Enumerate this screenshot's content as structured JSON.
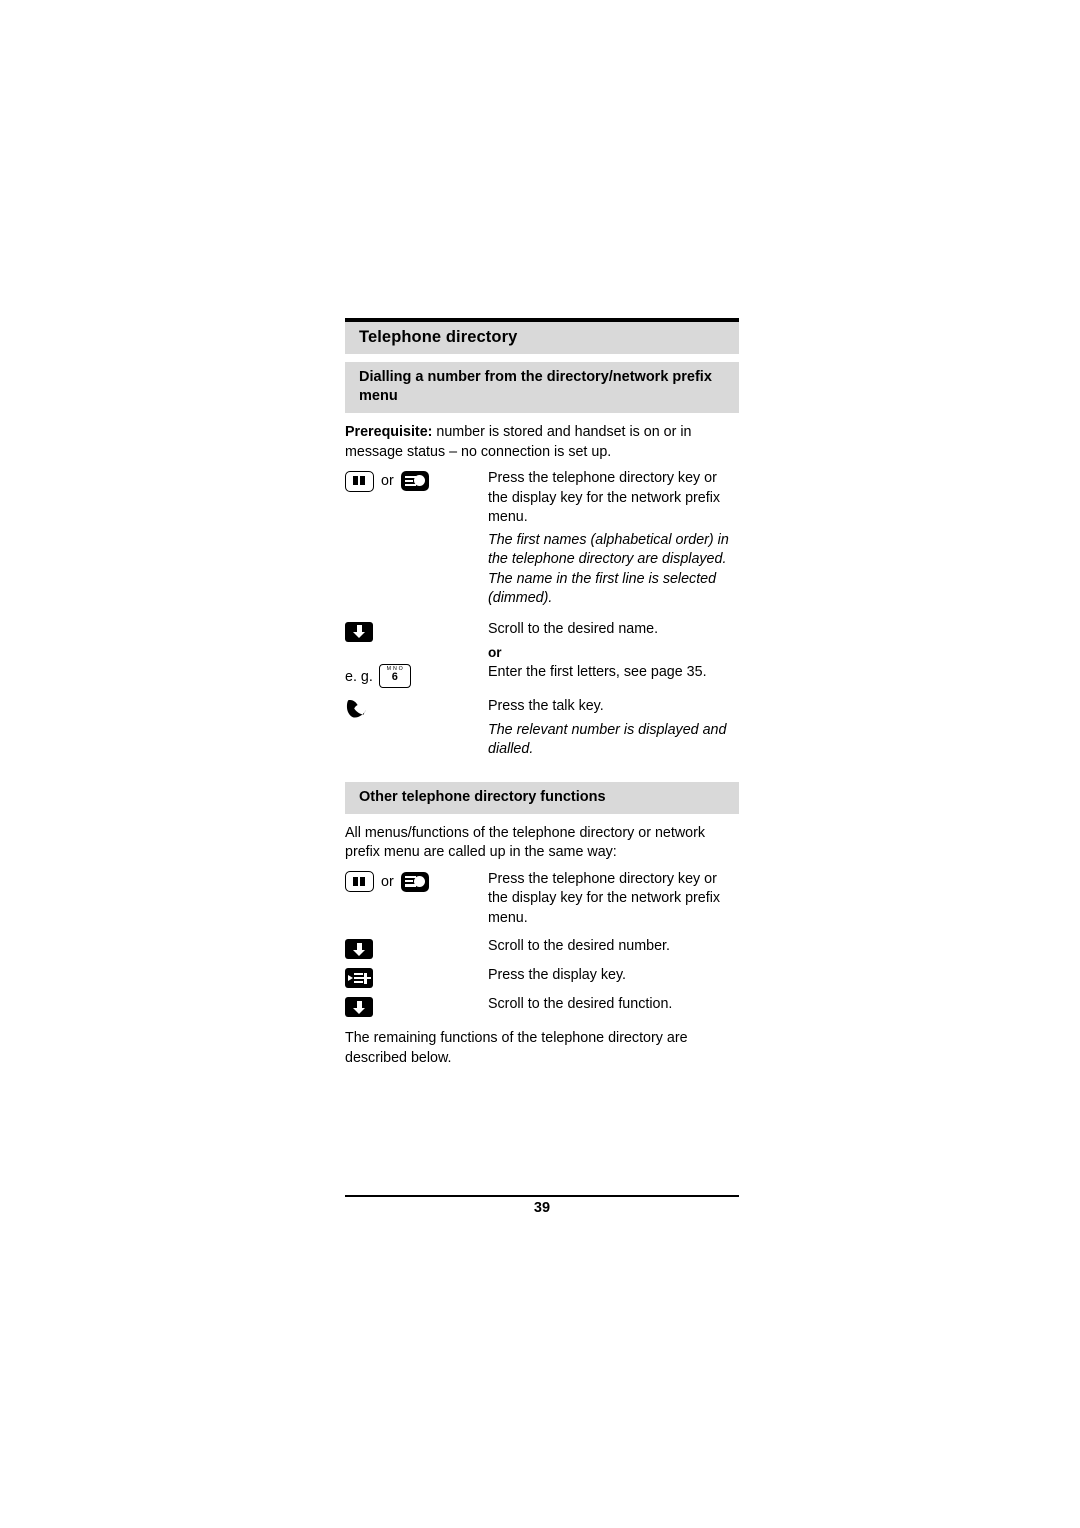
{
  "document": {
    "chapter_title": "Telephone directory",
    "page_number": "39",
    "sections": [
      {
        "heading": "Dialling a number from the directory/network prefix menu",
        "prerequisite_label": "Prerequisite:",
        "prerequisite_text": " number is stored and handset is on or in message status – no connection is set up.",
        "steps": [
          {
            "icons": "phonebook-key or display-key",
            "text": "Press the telephone directory key or the display key for the network prefix menu.",
            "note": "The first names (alphabetical order) in the telephone directory are displayed. The name in the first line is selected (dimmed)."
          },
          {
            "icons": "scroll-down-key",
            "text": "Scroll to the desired name."
          },
          {
            "or_label": "or",
            "prefix": "e. g.",
            "icons": "number-key-6",
            "text": "Enter the first letters, see page 35."
          },
          {
            "icons": "talk-key",
            "text": "Press the talk key.",
            "note": "The relevant number is displayed and dialled."
          }
        ]
      },
      {
        "heading": "Other telephone directory functions",
        "intro": "All menus/functions of the telephone directory or network prefix menu are called up in the same way:",
        "steps": [
          {
            "icons": "phonebook-key or display-key",
            "text": "Press the telephone directory key or the display key for the network prefix menu."
          },
          {
            "icons": "scroll-down-key",
            "text": "Scroll to the desired number."
          },
          {
            "icons": "display-key-plus",
            "text": "Press the display key."
          },
          {
            "icons": "scroll-down-key",
            "text": "Scroll to the desired function."
          }
        ],
        "closing": "The remaining functions of the telephone directory are described below."
      }
    ],
    "key_labels": {
      "or": "or",
      "key6_letters": "M N O",
      "key6_digit": "6"
    }
  }
}
